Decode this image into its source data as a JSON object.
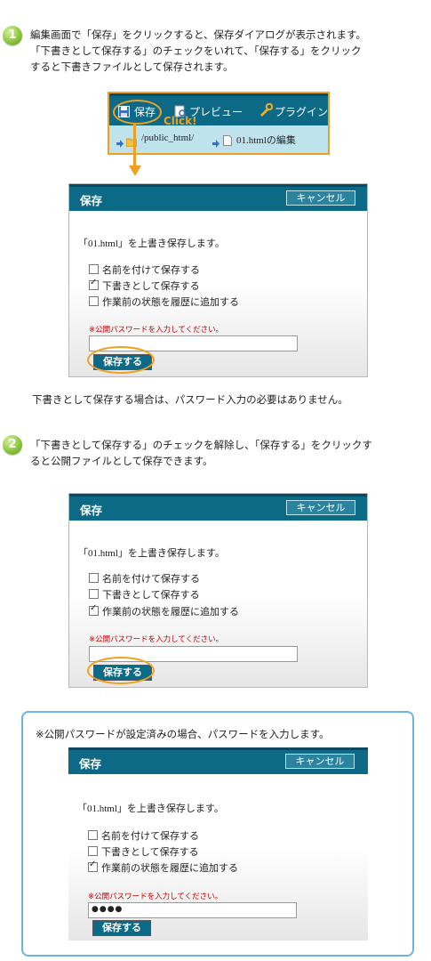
{
  "step1": {
    "number": "1",
    "line1": "編集画面で「保存」をクリックすると、保存ダイアログが表示されます。",
    "line2": "「下書きとして保存する」のチェックをいれて、「保存する」をクリック",
    "line3": "すると下書きファイルとして保存されます。"
  },
  "toolbar": {
    "save_label": "保存",
    "preview_label": "プレビュー",
    "plugin_label": "プラグイン",
    "click_label": "Click!",
    "crumb_path": "/public_html/",
    "crumb_file": "01.htmlの編集"
  },
  "dialog1": {
    "title": "保存",
    "cancel": "キャンセル",
    "message": "「01.html」を上書き保存します。",
    "options": [
      "名前を付けて保存する",
      "下書きとして保存する",
      "作業前の状態を履歴に追加する"
    ],
    "checked": [
      false,
      true,
      false
    ],
    "pw_label": "※公開パスワードを入力してください。",
    "pw_value": "",
    "save": "保存する"
  },
  "note1": "下書きとして保存する場合は、パスワード入力の必要はありません。",
  "step2": {
    "number": "2",
    "line1": "「下書きとして保存する」のチェックを解除し、「保存する」をクリックす",
    "line2": "ると公開ファイルとして保存できます。"
  },
  "dialog2": {
    "title": "保存",
    "cancel": "キャンセル",
    "message": "「01.html」を上書き保存します。",
    "options": [
      "名前を付けて保存する",
      "下書きとして保存する",
      "作業前の状態を履歴に追加する"
    ],
    "checked": [
      false,
      false,
      true
    ],
    "pw_label": "※公開パスワードを入力してください。",
    "pw_value": "",
    "save": "保存する"
  },
  "box3": {
    "note": "※公開パスワードが設定済みの場合、パスワードを入力します。"
  },
  "dialog3": {
    "title": "保存",
    "cancel": "キャンセル",
    "message": "「01.html」を上書き保存します。",
    "options": [
      "名前を付けて保存する",
      "下書きとして保存する",
      "作業前の状態を履歴に追加する"
    ],
    "checked": [
      false,
      false,
      true
    ],
    "pw_label": "※公開パスワードを入力してください。",
    "pw_value": "●●●●",
    "save": "保存する"
  },
  "colors": {
    "accent": "#0d6a86",
    "highlight": "#f0a020",
    "step": "#8cc63f",
    "frame": "#6ab4de",
    "warning": "#c00000"
  }
}
